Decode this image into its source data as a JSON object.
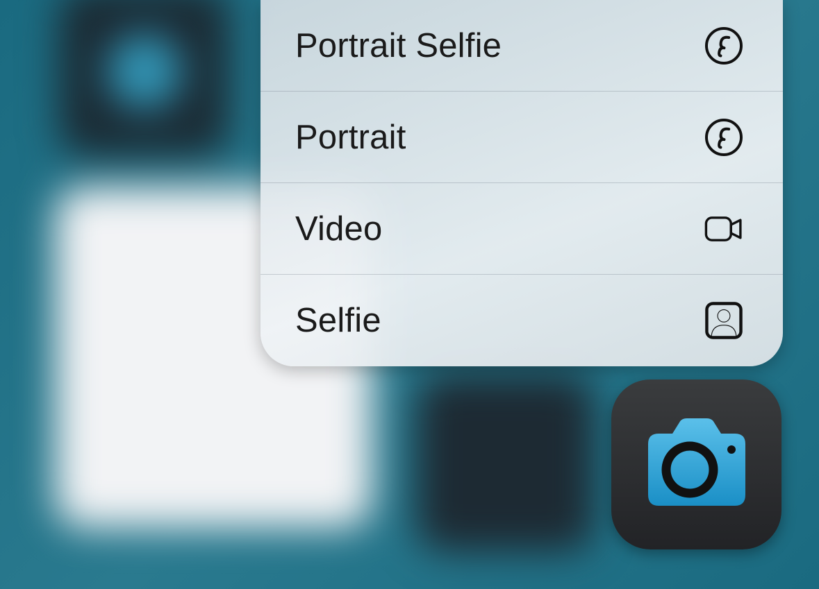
{
  "menu": {
    "items": [
      {
        "label": "Portrait Selfie",
        "icon": "aperture-f-icon"
      },
      {
        "label": "Portrait",
        "icon": "aperture-f-icon"
      },
      {
        "label": "Video",
        "icon": "video-camera-icon"
      },
      {
        "label": "Selfie",
        "icon": "person-square-icon"
      }
    ]
  },
  "app": {
    "name": "Camera",
    "icon": "camera-icon"
  }
}
